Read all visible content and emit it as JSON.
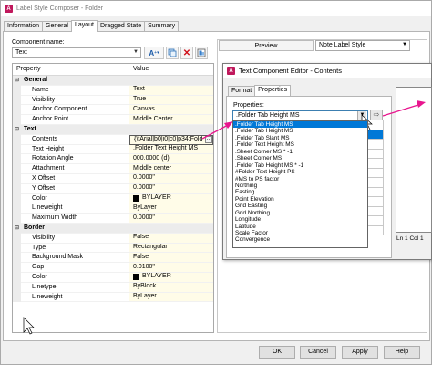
{
  "window": {
    "title": "Label Style Composer - Folder",
    "icon_letter": "A"
  },
  "tabs": [
    {
      "label": "Information",
      "active": false
    },
    {
      "label": "General",
      "active": false
    },
    {
      "label": "Layout",
      "active": true
    },
    {
      "label": "Dragged State",
      "active": false
    },
    {
      "label": "Summary",
      "active": false
    }
  ],
  "component": {
    "label": "Component name:",
    "value": "Text"
  },
  "grid": {
    "col_property": "Property",
    "col_value": "Value",
    "rows": [
      {
        "kind": "cat",
        "name": "General",
        "value": ""
      },
      {
        "kind": "prop",
        "name": "Name",
        "value": "Text"
      },
      {
        "kind": "prop",
        "name": "Visibility",
        "value": "True"
      },
      {
        "kind": "prop",
        "name": "Anchor Component",
        "value": "Canvas"
      },
      {
        "kind": "prop",
        "name": "Anchor Point",
        "value": "Middle Center"
      },
      {
        "kind": "cat",
        "name": "Text",
        "value": ""
      },
      {
        "kind": "prop",
        "name": "Contents",
        "value": "{\\fArial|b0|i0|c0|p34;Fold",
        "selected": true
      },
      {
        "kind": "prop",
        "name": "Text Height",
        "value": ".Folder Text Height MS"
      },
      {
        "kind": "prop",
        "name": "Rotation Angle",
        "value": "000.0000 (d)"
      },
      {
        "kind": "prop",
        "name": "Attachment",
        "value": "Middle center"
      },
      {
        "kind": "prop",
        "name": "X Offset",
        "value": "0.0000\""
      },
      {
        "kind": "prop",
        "name": "Y Offset",
        "value": "0.0000\""
      },
      {
        "kind": "prop",
        "name": "Color",
        "value": "BYLAYER",
        "swatch": true
      },
      {
        "kind": "prop",
        "name": "Lineweight",
        "value": "ByLayer"
      },
      {
        "kind": "prop",
        "name": "Maximum Width",
        "value": "0.0000\""
      },
      {
        "kind": "cat",
        "name": "Border",
        "value": ""
      },
      {
        "kind": "prop",
        "name": "Visibility",
        "value": "False"
      },
      {
        "kind": "prop",
        "name": "Type",
        "value": "Rectangular"
      },
      {
        "kind": "prop",
        "name": "Background Mask",
        "value": "False"
      },
      {
        "kind": "prop",
        "name": "Gap",
        "value": "0.0100\""
      },
      {
        "kind": "prop",
        "name": "Color",
        "value": "BYLAYER",
        "swatch": true
      },
      {
        "kind": "prop",
        "name": "Linetype",
        "value": "ByBlock"
      },
      {
        "kind": "prop",
        "name": "Lineweight",
        "value": "ByLayer"
      }
    ]
  },
  "preview": {
    "button": "Preview",
    "style": "Note Label Style"
  },
  "buttons": {
    "ok": "OK",
    "cancel": "Cancel",
    "apply": "Apply",
    "help": "Help"
  },
  "editor": {
    "title": "Text Component Editor - Contents",
    "tabs": [
      {
        "label": "Format",
        "active": false
      },
      {
        "label": "Properties",
        "active": true
      }
    ],
    "properties_label": "Properties:",
    "selected": ".Folder Tab Height MS",
    "status": "Ln 1 Col 1",
    "list": [
      ".Folder Tab Height MS",
      ".Folder Tab Height MS",
      ".Folder Tab Slant MS",
      ".Folder Text Height MS",
      ".Sheet Corner MS * -1",
      ".Sheet Corner MS",
      ".Folder Tab Height MS * -1",
      "#Folder Text Height PS",
      "#MS to PS factor",
      "Northing",
      "Easting",
      "Point Elevation",
      "Grid Easting",
      "Grid Northing",
      "Longitude",
      "Latitude",
      "Scale Factor",
      "Convergence"
    ]
  },
  "colors": {
    "accent": "#0078d7",
    "arrow": "#e8158e",
    "value_bg": "#fffce8",
    "app_icon": "#c0185c"
  }
}
